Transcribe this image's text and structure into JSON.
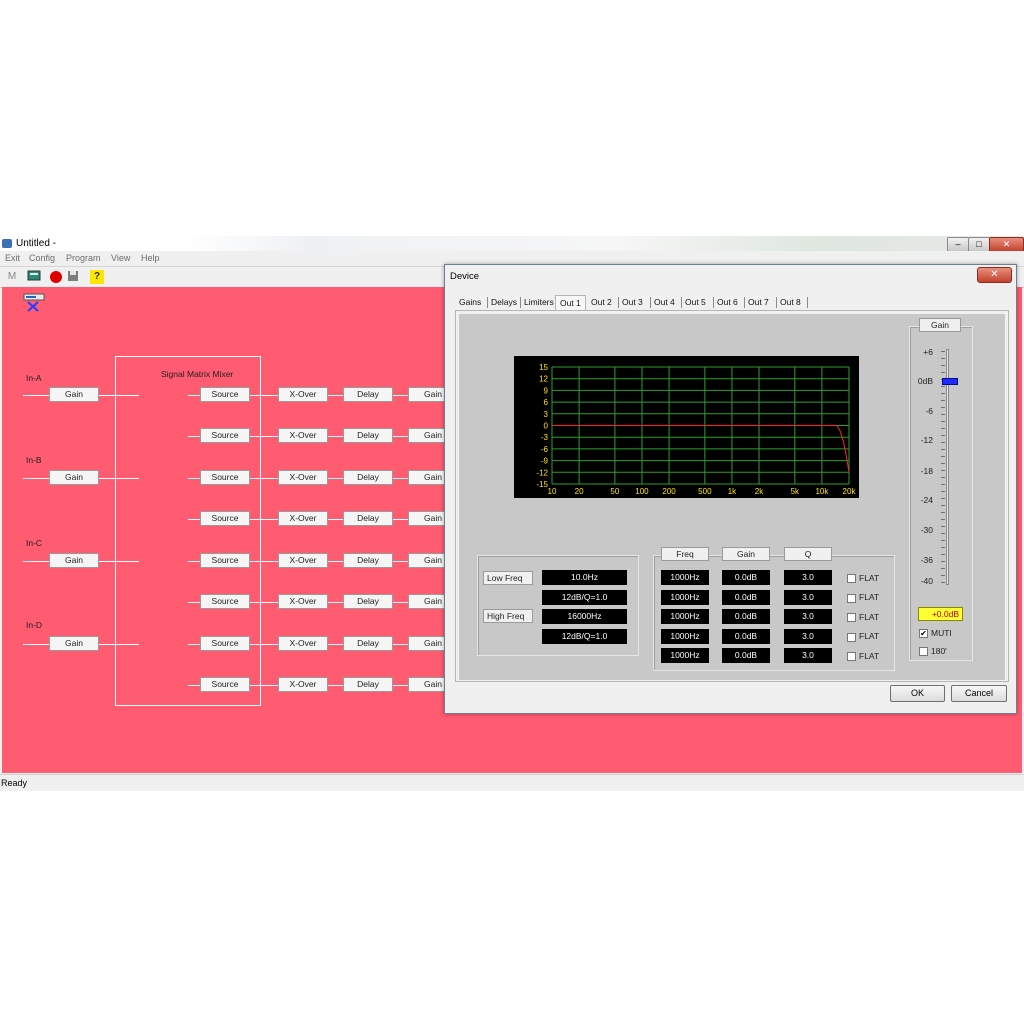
{
  "window": {
    "title": "Untitled -",
    "controls": [
      "–",
      "□",
      "✕"
    ]
  },
  "menu": [
    "Exit",
    "Config",
    "Program",
    "View",
    "Help"
  ],
  "toolbar": {
    "m_label": "M",
    "help_glyph": "?"
  },
  "mixer": {
    "title": "Signal Matrix Mixer",
    "inputs": [
      {
        "label": "In-A",
        "gain": "Gain"
      },
      {
        "label": "In-B",
        "gain": "Gain"
      },
      {
        "label": "In-C",
        "gain": "Gain"
      },
      {
        "label": "In-D",
        "gain": "Gain"
      }
    ],
    "source_label": "Source",
    "xover_label": "X-Over",
    "delay_label": "Delay",
    "gain_label": "Gain"
  },
  "status": "Ready",
  "device": {
    "title": "Device",
    "close": "✕",
    "tabs": [
      "Gains",
      "Delays",
      "Limiters",
      "Out 1",
      "Out 2",
      "Out 3",
      "Out 4",
      "Out 5",
      "Out 6",
      "Out 7",
      "Out 8"
    ],
    "active_tab": "Out 1",
    "graph": {
      "y_ticks": [
        "15",
        "12",
        "9",
        "6",
        "3",
        "0",
        "-3",
        "-6",
        "-9",
        "-12",
        "-15"
      ],
      "x_ticks": [
        "10",
        "20",
        "50",
        "100",
        "200",
        "500",
        "1k",
        "2k",
        "5k",
        "10k",
        "20k"
      ]
    },
    "filters": {
      "low_label": "Low Freq",
      "low_freq": "10.0Hz",
      "low_slope": "12dB/Q=1.0",
      "high_label": "High Freq",
      "high_freq": "16000Hz",
      "high_slope": "12dB/Q=1.0"
    },
    "peq": {
      "headers": {
        "freq": "Freq",
        "gain": "Gain",
        "q": "Q"
      },
      "flat_label": "FLAT",
      "rows": [
        {
          "freq": "1000Hz",
          "gain": "0.0dB",
          "q": "3.0"
        },
        {
          "freq": "1000Hz",
          "gain": "0.0dB",
          "q": "3.0"
        },
        {
          "freq": "1000Hz",
          "gain": "0.0dB",
          "q": "3.0"
        },
        {
          "freq": "1000Hz",
          "gain": "0.0dB",
          "q": "3.0"
        },
        {
          "freq": "1000Hz",
          "gain": "0.0dB",
          "q": "3.0"
        }
      ]
    },
    "gain_panel": {
      "title": "Gain",
      "ticks": [
        "+6",
        "0dB",
        "-6",
        "-12",
        "-18",
        "-24",
        "-30",
        "-36",
        "-40"
      ],
      "value": "+0.0dB",
      "slider_level_db": 0,
      "muti_label": "MUTI",
      "muti_checked": true,
      "phase_label": "180'",
      "phase_checked": false
    },
    "ok": "OK",
    "cancel": "Cancel"
  },
  "colors": {
    "canvas": "#ff5b71",
    "graph_grid": "#2e9e2e",
    "graph_labels": "#ffe600",
    "curve": "#ff2020",
    "slider_thumb": "#1f2bff",
    "gain_value_bg": "#ffff33"
  }
}
